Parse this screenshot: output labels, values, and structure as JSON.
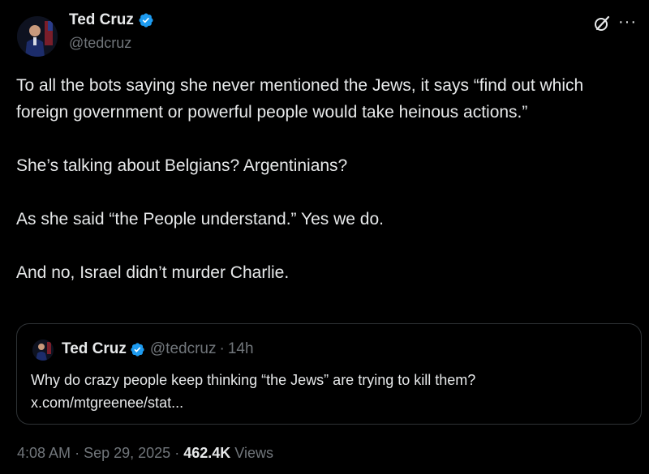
{
  "colors": {
    "background": "#000000",
    "text": "#e7e9ea",
    "muted": "#71767b",
    "verified": "#1d9bf0",
    "border": "#2f3336"
  },
  "icons": {
    "verified": "verified-badge-icon",
    "grok": "grok-icon",
    "more": "more-icon"
  },
  "post": {
    "author": {
      "name": "Ted Cruz",
      "handle": "@tedcruz"
    },
    "more_label": "···",
    "paragraphs": [
      "To all the bots saying she never mentioned the Jews, it says “find out which foreign government or powerful people would take heinous actions.”",
      "She’s talking about Belgians? Argentinians?",
      "As she said “the People understand.” Yes we do.",
      "And no, Israel didn’t murder Charlie."
    ],
    "quote": {
      "name": "Ted Cruz",
      "handle": "@tedcruz",
      "separator": "·",
      "time": "14h",
      "text": "Why do crazy people keep thinking “the Jews” are trying to kill them?",
      "link": "x.com/mtgreenee/stat..."
    },
    "meta": {
      "time": "4:08 AM",
      "separator": "·",
      "date": "Sep 29, 2025",
      "views_count": "462.4K",
      "views_label": "Views"
    }
  }
}
